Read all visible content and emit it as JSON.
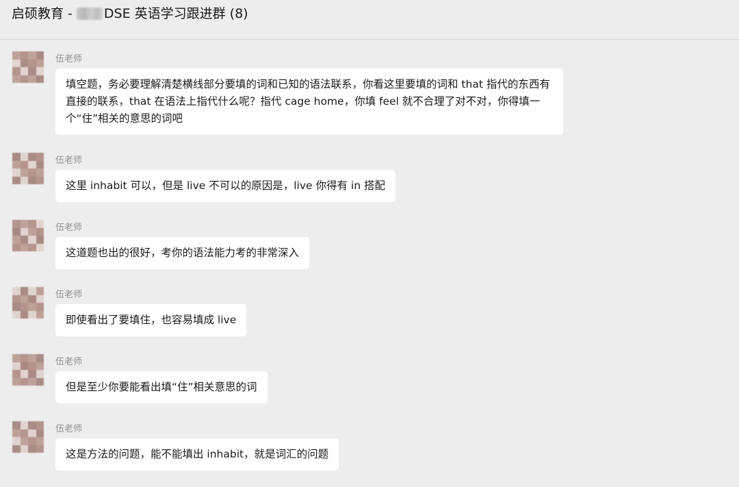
{
  "header": {
    "title_prefix": "启硕教育 -",
    "title_suffix": "DSE 英语学习跟进群 (8)"
  },
  "messages": [
    {
      "sender": "伍老师",
      "text": "填空题，务必要理解清楚横线部分要填的词和已知的语法联系，你看这里要填的词和 that 指代的东西有直接的联系，that 在语法上指代什么呢？指代 cage home，你填 feel 就不合理了对不对，你得填一个“住”相关的意思的词吧"
    },
    {
      "sender": "伍老师",
      "text": "这里 inhabit 可以，但是 live 不可以的原因是，live 你得有 in 搭配"
    },
    {
      "sender": "伍老师",
      "text": "这道题也出的很好，考你的语法能力考的非常深入"
    },
    {
      "sender": "伍老师",
      "text": "即使看出了要填住，也容易填成 live"
    },
    {
      "sender": "伍老师",
      "text": "但是至少你要能看出填“住”相关意思的词"
    },
    {
      "sender": "伍老师",
      "text": "这是方法的问题，能不能填出 inhabit，就是词汇的问题"
    }
  ],
  "colors": {
    "background": "#ededed",
    "bubble": "#ffffff",
    "sender_name": "#8f8f8f"
  },
  "icons": {
    "avatar": "pixelated-avatar"
  }
}
